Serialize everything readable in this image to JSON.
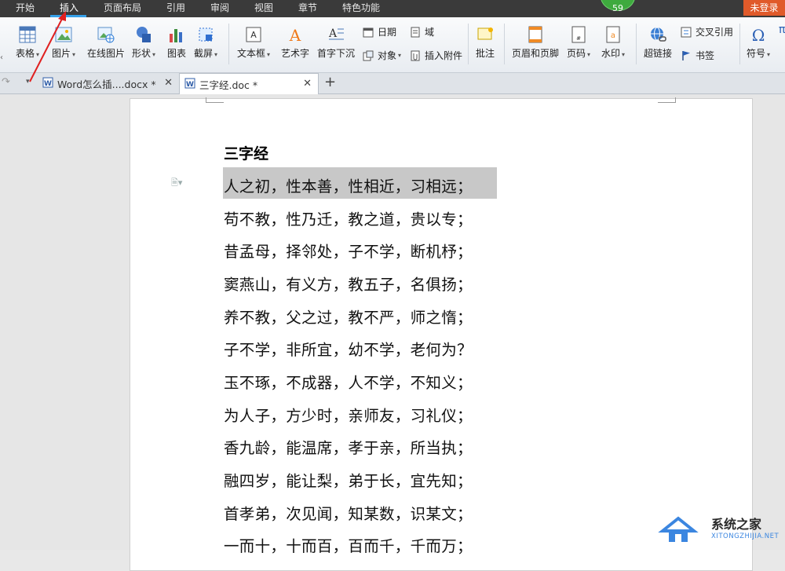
{
  "menu": {
    "items": [
      "开始",
      "插入",
      "页面布局",
      "引用",
      "审阅",
      "视图",
      "章节",
      "特色功能"
    ],
    "badge": "59",
    "login": "未登录"
  },
  "ribbon": {
    "table": "表格",
    "picture": "图片",
    "online_picture": "在线图片",
    "shape": "形状",
    "chart": "图表",
    "screenshot": "截屏",
    "textbox": "文本框",
    "wordart": "艺术字",
    "dropcap": "首字下沉",
    "date": "日期",
    "field": "域",
    "object": "对象",
    "attachment": "插入附件",
    "comment": "批注",
    "header_footer": "页眉和页脚",
    "page_number": "页码",
    "watermark": "水印",
    "hyperlink": "超链接",
    "cross_reference": "交叉引用",
    "bookmark": "书签",
    "symbol": "符号"
  },
  "tabs": [
    {
      "label": "Word怎么插....docx *"
    },
    {
      "label": "三字经.doc *"
    }
  ],
  "document": {
    "title": "三字经",
    "lines": [
      "人之初，性本善，性相近，习相远；",
      "苟不教，性乃迁，教之道，贵以专；",
      "昔孟母，择邻处，子不学，断机杼；",
      "窦燕山，有义方，教五子，名俱扬；",
      "养不教，父之过，教不严，师之惰；",
      "子不学，非所宜，幼不学，老何为？",
      "玉不琢，不成器，人不学，不知义；",
      "为人子，方少时，亲师友，习礼仪；",
      "香九龄，能温席，孝于亲，所当执；",
      "融四岁，能让梨，弟于长，宜先知；",
      "首孝弟，次见闻，知某数，识某文；",
      "一而十，十而百，百而千，千而万；"
    ]
  },
  "watermark": {
    "name": "系统之家",
    "url": "XITONGZHIJIA.NET"
  },
  "colors": {
    "menubar": "#3a3a3a",
    "accent": "#36a0e8",
    "login": "#e05a2a",
    "badge": "#3eaa3e",
    "selection": "#c8c8c8",
    "arrow": "#e02020"
  }
}
